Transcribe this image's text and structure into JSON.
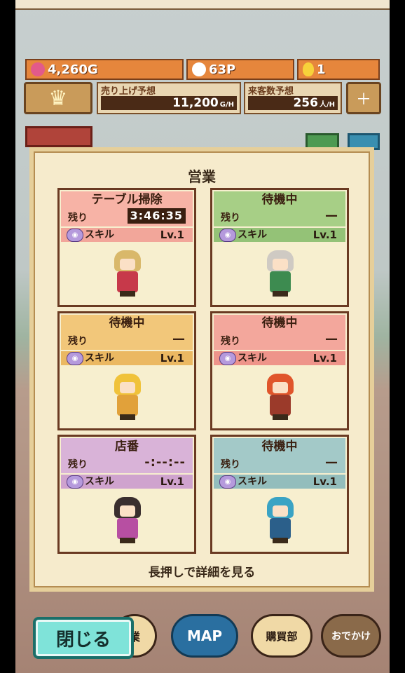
{
  "resources": {
    "gold": "4,260G",
    "points": "63P",
    "eggs": "1"
  },
  "forecast": {
    "sales_label": "売り上げ予想",
    "sales_value": "11,200",
    "sales_unit": "G/H",
    "visitors_label": "来客数予想",
    "visitors_value": "256",
    "visitors_unit": "人/H"
  },
  "panel": {
    "title": "営業",
    "footer": "長押しで詳細を見る"
  },
  "staff": [
    {
      "task": "テーブル掃除",
      "remain_label": "残り",
      "remain": "3:46:35",
      "skill_label": "スキル",
      "level": "Lv.1"
    },
    {
      "task": "待機中",
      "remain_label": "残り",
      "remain": "—",
      "skill_label": "スキル",
      "level": "Lv.1"
    },
    {
      "task": "待機中",
      "remain_label": "残り",
      "remain": "—",
      "skill_label": "スキル",
      "level": "Lv.1"
    },
    {
      "task": "待機中",
      "remain_label": "残り",
      "remain": "—",
      "skill_label": "スキル",
      "level": "Lv.1"
    },
    {
      "task": "店番",
      "remain_label": "残り",
      "remain": "-:--:--",
      "skill_label": "スキル",
      "level": "Lv.1"
    },
    {
      "task": "待機中",
      "remain_label": "残り",
      "remain": "—",
      "skill_label": "スキル",
      "level": "Lv.1"
    }
  ],
  "nav": {
    "close": "閉じる",
    "business": "業",
    "map": "MAP",
    "shop": "購買部",
    "outing": "おでかけ"
  },
  "colors": {
    "pink_header": "#f7b3a6",
    "green_header": "#a7cf86",
    "orange_header": "#f2c77a",
    "purple_header": "#d9b3d8",
    "teal_header": "#a3c9c8"
  }
}
